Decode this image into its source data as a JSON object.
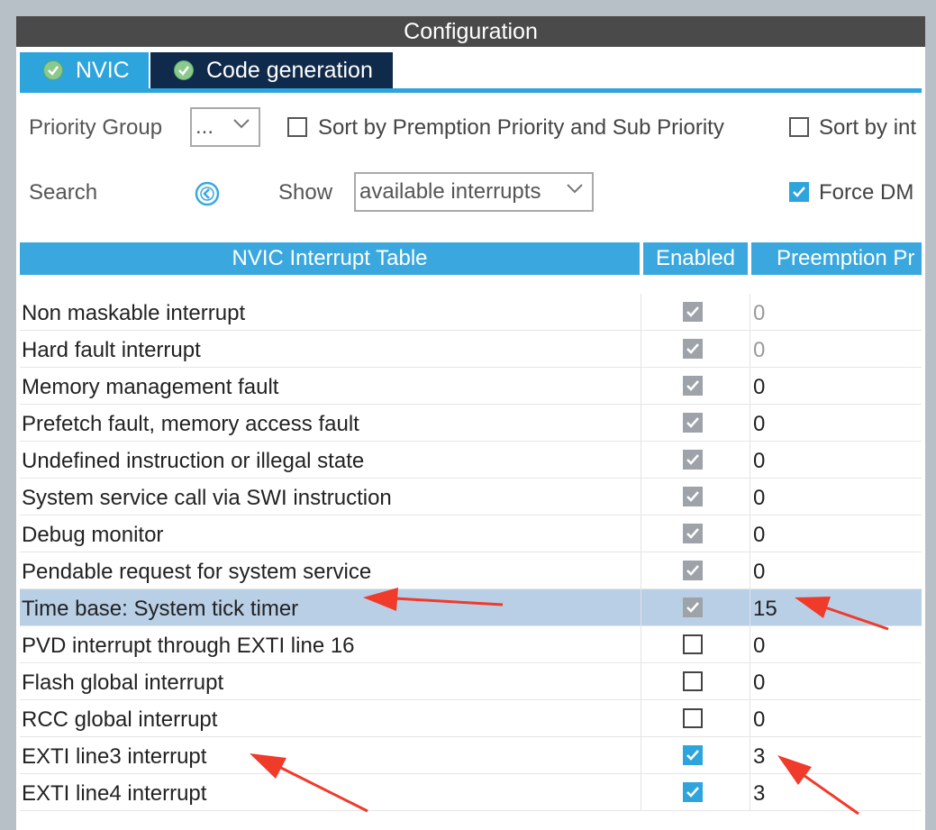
{
  "title": "Configuration",
  "tabs": [
    {
      "label": "NVIC",
      "icon": "check-circle-icon"
    },
    {
      "label": "Code generation",
      "icon": "check-circle-icon"
    }
  ],
  "toolbar": {
    "priority_group_label": "Priority Group",
    "priority_group_value": "...",
    "sort_premption_label": "Sort by Premption Priority and Sub Priority",
    "sort_by_int_label": "Sort by int",
    "search_label": "Search",
    "show_label": "Show",
    "show_value": "available interrupts",
    "force_label": "Force DM",
    "force_checked": true,
    "sort_premption_checked": false,
    "sort_by_int_checked": false
  },
  "table": {
    "headers": [
      "NVIC Interrupt Table",
      "Enabled",
      "Preemption Pr"
    ],
    "rows": [
      {
        "name": "Non maskable interrupt",
        "enabled": "disabled",
        "priority": "0",
        "dim": true
      },
      {
        "name": "Hard fault interrupt",
        "enabled": "disabled",
        "priority": "0",
        "dim": true
      },
      {
        "name": "Memory management fault",
        "enabled": "disabled",
        "priority": "0"
      },
      {
        "name": "Prefetch fault, memory access fault",
        "enabled": "disabled",
        "priority": "0"
      },
      {
        "name": "Undefined instruction or illegal state",
        "enabled": "disabled",
        "priority": "0"
      },
      {
        "name": "System service call via SWI instruction",
        "enabled": "disabled",
        "priority": "0"
      },
      {
        "name": "Debug monitor",
        "enabled": "disabled",
        "priority": "0"
      },
      {
        "name": "Pendable request for system service",
        "enabled": "disabled",
        "priority": "0"
      },
      {
        "name": "Time base: System tick timer",
        "enabled": "disabled",
        "priority": "15",
        "selected": true
      },
      {
        "name": "PVD interrupt through EXTI line 16",
        "enabled": "off",
        "priority": "0"
      },
      {
        "name": "Flash global interrupt",
        "enabled": "off",
        "priority": "0"
      },
      {
        "name": "RCC global interrupt",
        "enabled": "off",
        "priority": "0"
      },
      {
        "name": "EXTI line3 interrupt",
        "enabled": "on",
        "priority": "3"
      },
      {
        "name": "EXTI line4 interrupt",
        "enabled": "on",
        "priority": "3"
      }
    ]
  },
  "colors": {
    "accent": "#2ea4dd",
    "header": "#3aa8de",
    "title_bar": "#4a4a4a",
    "code_tab": "#0f2a4a",
    "selected_row": "#b9cfe6",
    "annotation_arrow": "#f03a2a"
  }
}
